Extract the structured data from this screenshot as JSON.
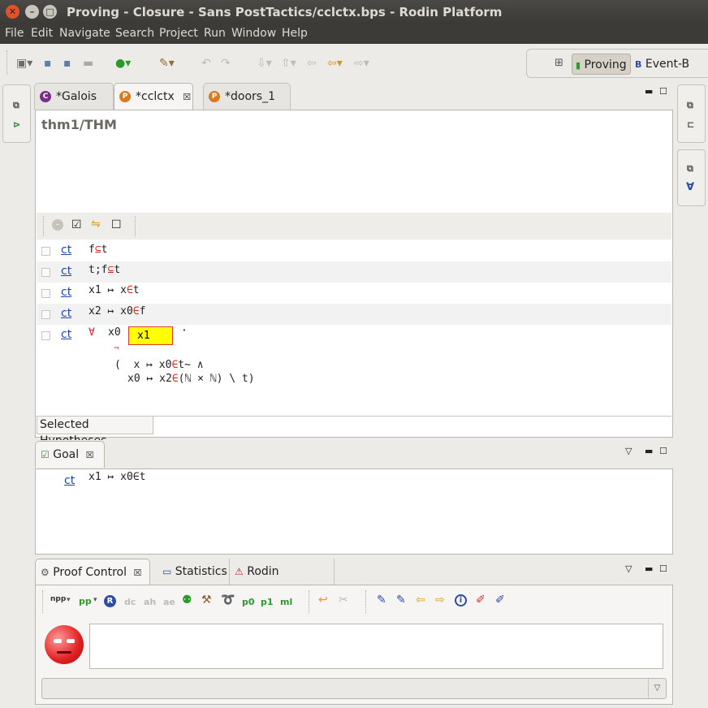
{
  "window": {
    "title": "Proving - Closure - Sans PostTactics/cclctx.bps - Rodin Platform",
    "buttons": [
      "close-icon",
      "minimize-icon",
      "maximize-icon"
    ]
  },
  "menu": [
    "File",
    "Edit",
    "Navigate",
    "Search",
    "Project",
    "Run",
    "Window",
    "Help"
  ],
  "perspectives": {
    "proving": "Proving",
    "eventb": "Event-B"
  },
  "editor": {
    "tabs": [
      {
        "label": "*Galois",
        "icon": "C",
        "color": "#7a2d8c"
      },
      {
        "label": "*cclctx",
        "icon": "P",
        "color": "#d97a1c"
      },
      {
        "label": "*doors_1",
        "icon": "P",
        "color": "#d97a1c"
      }
    ],
    "proof_name": "thm1/THM",
    "hyp_toolbar": [
      "remove-icon",
      "select-all-icon",
      "invert-icon",
      "deselect-icon"
    ],
    "hypotheses": [
      {
        "link": "ct",
        "parts": [
          "f",
          "⊆",
          "t"
        ]
      },
      {
        "link": "ct",
        "parts": [
          "t;f",
          "⊆",
          "t"
        ]
      },
      {
        "link": "ct",
        "parts": [
          "x1 ↦ x",
          "∈",
          "t"
        ]
      },
      {
        "link": "ct",
        "parts": [
          "x2 ↦ x0",
          "∈",
          "f"
        ]
      }
    ],
    "hyp5": {
      "link": "ct",
      "forall": "∀",
      "var": "x0",
      "input_value": "x1",
      "dot": "·",
      "neg": "¬",
      "line2a": "(  x ↦ x0",
      "line2b": "∈",
      "line2c": "t~ ∧",
      "line3a": "x0 ↦ x2",
      "line3b": "∈",
      "line3c": "(ℕ × ℕ) \\ t)"
    },
    "selected_hyp_tab": "Selected Hypotheses"
  },
  "goal": {
    "tab": "Goal",
    "link": "ct",
    "expr": "x1 ↦ x0∈t"
  },
  "proof_control": {
    "tabs": [
      "Proof Control",
      "Statistics",
      "Rodin Problems"
    ],
    "buttons": [
      "npp",
      "pp",
      "R",
      "dc",
      "ah",
      "ae",
      "p0",
      "p1",
      "ml"
    ],
    "input_placeholder": "",
    "dropdown_value": ""
  }
}
